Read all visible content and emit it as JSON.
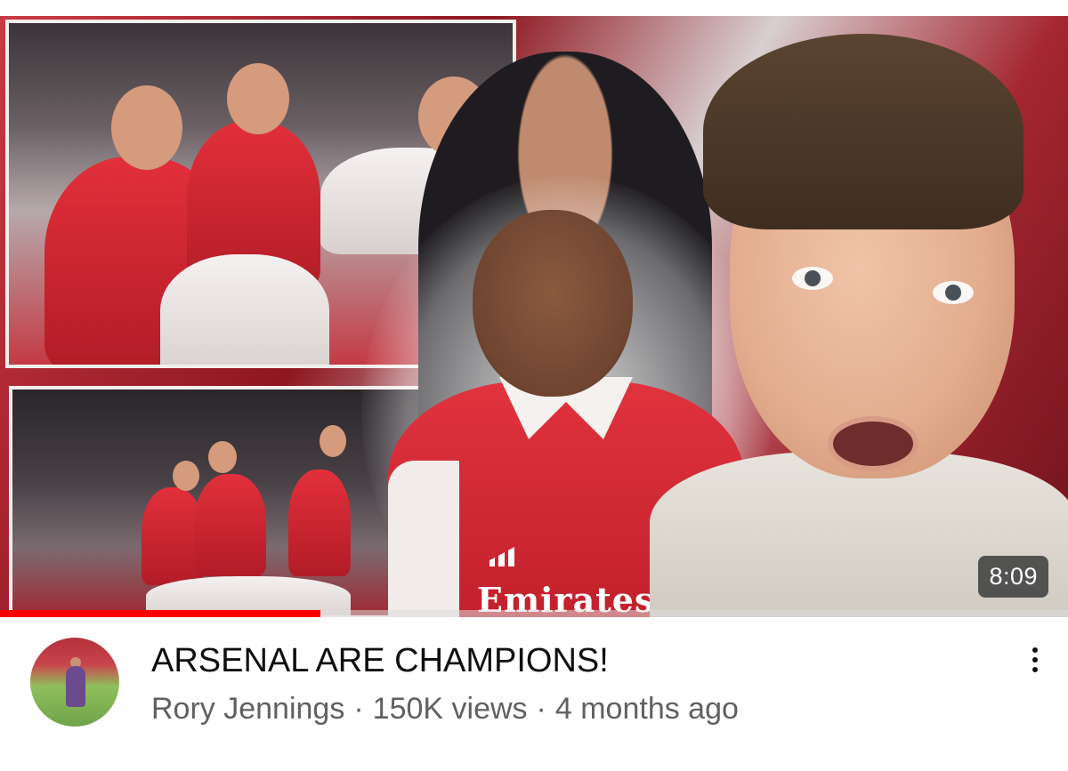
{
  "video": {
    "duration": "8:09",
    "watch_progress": 0.3,
    "sponsor_text": "Emirates"
  },
  "details": {
    "title": "ARSENAL ARE CHAMPIONS!",
    "channel": "Rory Jennings",
    "separator": "·",
    "views": "150K views",
    "age": "4 months ago"
  },
  "icons": {
    "more": "more-vert-icon"
  },
  "colors": {
    "progress": "#ff0000",
    "title": "#0f0f0f",
    "meta": "#606060"
  }
}
